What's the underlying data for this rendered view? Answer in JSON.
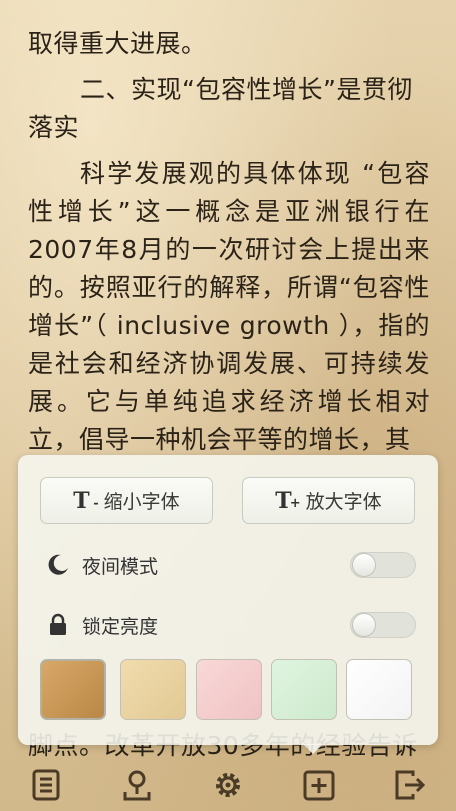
{
  "reading": {
    "line_prev": "取得重大进展。",
    "heading": "二、实现“包容性增长”是贯彻落实",
    "para1": "科学发展观的具体体现 “包容性增长”这一概念是亚洲银行在2007年8月的一次研讨会上提出来的。按照亚行的解释，所谓“包容性增长”（ inclusive growth ），指的是社会和经济协调发展、可持续发展。它与单纯追求经济增长相对立，倡导一种机会平等的增长，其",
    "bottom_line": "脚点。改革开放30多年的经验告诉"
  },
  "panel": {
    "shrink_label": "缩小字体",
    "shrink_glyph": "T",
    "shrink_sign": "-",
    "enlarge_label": "放大字体",
    "enlarge_glyph": "T",
    "enlarge_sign": "+",
    "night_mode_label": "夜间模式",
    "night_mode_on": false,
    "lock_brightness_label": "锁定亮度",
    "lock_brightness_on": false,
    "themes": [
      "#c99b5e",
      "#ead4a2",
      "#f6cfcf",
      "#d6efd6",
      "#ffffff"
    ],
    "selected_theme": 0
  },
  "colors": {
    "text": "#2b2218",
    "panel_bg": "#f6f7f0",
    "icon": "#4a3a26"
  },
  "toolbar": {
    "icons": [
      "list-icon",
      "bookmark-pin-icon",
      "gear-icon",
      "add-box-icon",
      "exit-icon"
    ]
  }
}
